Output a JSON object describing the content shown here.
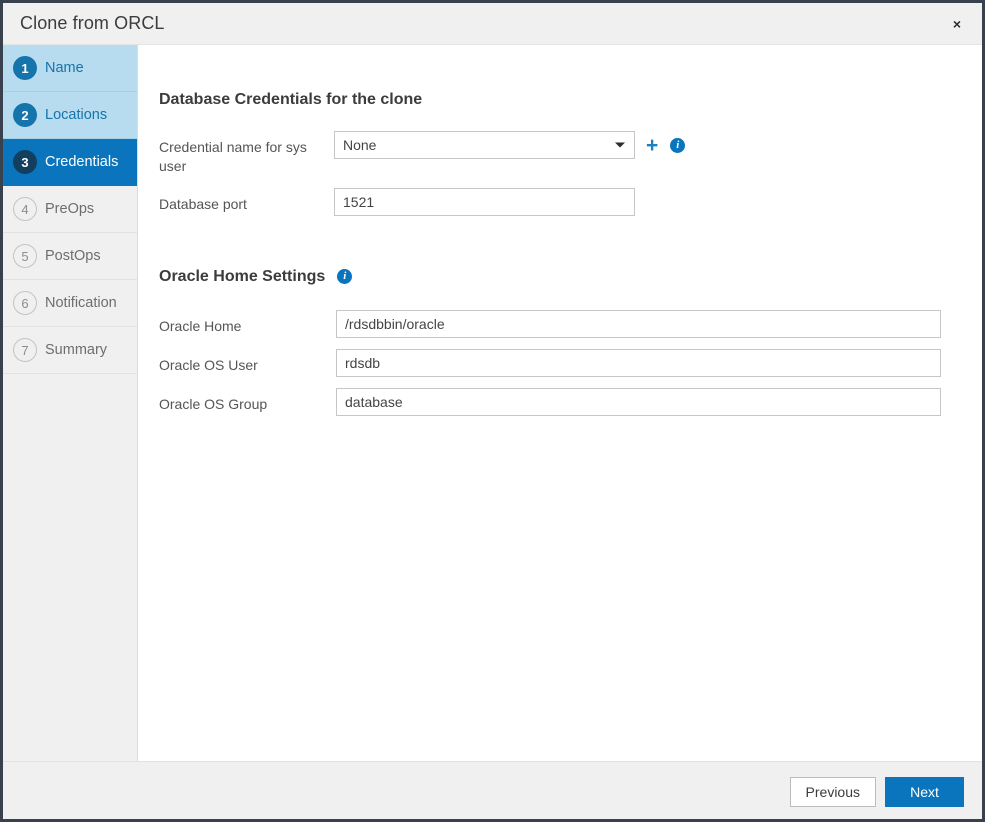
{
  "window": {
    "title": "Clone from ORCL",
    "close_label": "×"
  },
  "sidebar": {
    "steps": [
      {
        "num": "1",
        "label": "Name",
        "state": "done"
      },
      {
        "num": "2",
        "label": "Locations",
        "state": "done"
      },
      {
        "num": "3",
        "label": "Credentials",
        "state": "active"
      },
      {
        "num": "4",
        "label": "PreOps",
        "state": "pending"
      },
      {
        "num": "5",
        "label": "PostOps",
        "state": "pending"
      },
      {
        "num": "6",
        "label": "Notification",
        "state": "pending"
      },
      {
        "num": "7",
        "label": "Summary",
        "state": "pending"
      }
    ]
  },
  "credentials_section": {
    "heading": "Database Credentials for the clone",
    "sys_credential": {
      "label": "Credential name for sys user",
      "value": "None",
      "add_label": "+",
      "info_label": "i"
    },
    "db_port": {
      "label": "Database port",
      "value": "1521"
    }
  },
  "oracle_home_section": {
    "heading": "Oracle Home Settings",
    "info_label": "i",
    "fields": [
      {
        "label": "Oracle Home",
        "value": "/rdsdbbin/oracle"
      },
      {
        "label": "Oracle OS User",
        "value": "rdsdb"
      },
      {
        "label": "Oracle OS Group",
        "value": "database"
      }
    ]
  },
  "footer": {
    "previous_label": "Previous",
    "next_label": "Next"
  },
  "colors": {
    "accent": "#0a75bc",
    "step_done_bg": "#b8dcef",
    "step_done_circle": "#1474ab",
    "step_active_circle": "#123f5e",
    "chrome": "#f0f0f0",
    "window_border": "#39414e"
  }
}
